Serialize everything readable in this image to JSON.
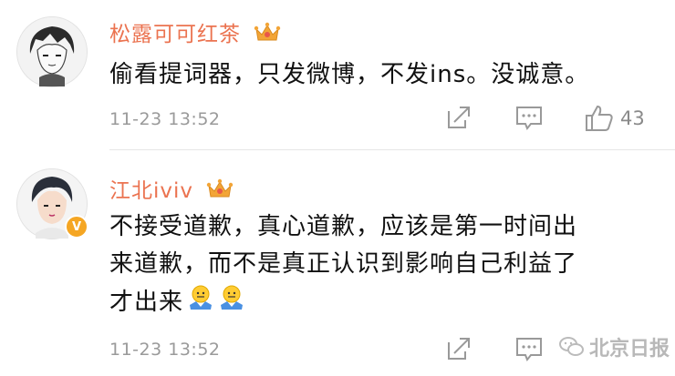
{
  "comments": [
    {
      "username": "松露可可红茶",
      "text": "偷看提词器，只发微博，不发ins。没诚意。",
      "timestamp": "11-23 13:52",
      "likes": "43",
      "verified": false,
      "avatar_icon": "anime-boy-avatar",
      "member_icon": "crown-icon"
    },
    {
      "username": "江北iviv",
      "text_lines": [
        "不接受道歉，真心道歉，应该是第一时间出",
        "来道歉，而不是真正认识到影响自己利益了",
        "才出来"
      ],
      "emojis": [
        "shrug-emoji",
        "shrug-emoji"
      ],
      "timestamp": "11-23 13:52",
      "verified": true,
      "verified_badge": "V",
      "avatar_icon": "cartoon-boy-avatar",
      "member_icon": "crown-icon"
    }
  ],
  "watermark": {
    "text": "北京日报",
    "icon": "wechat-icon"
  },
  "colors": {
    "username": "#eb7350",
    "meta": "#9a9a9a",
    "badge": "#f5a623"
  }
}
